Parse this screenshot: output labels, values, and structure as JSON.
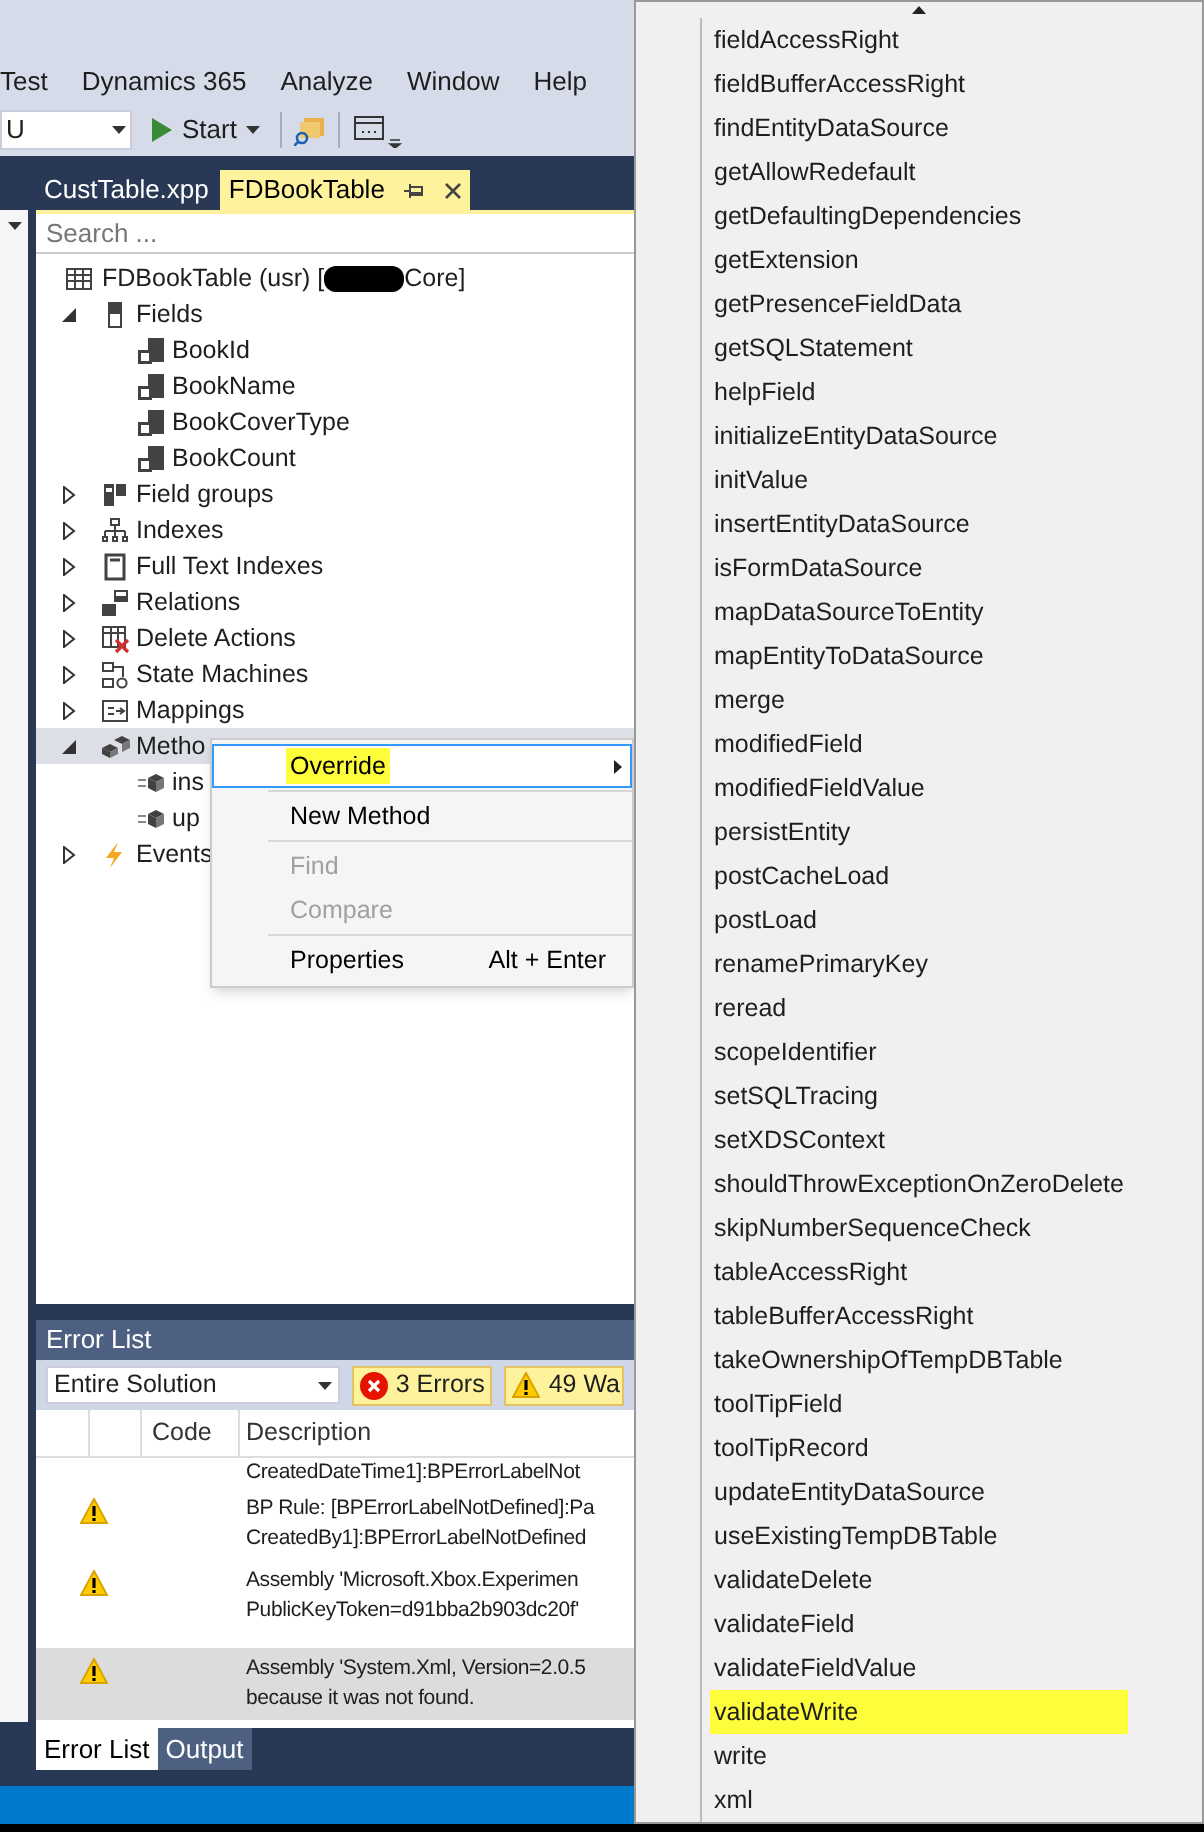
{
  "menu_bar": [
    "Test",
    "Dynamics 365",
    "Analyze",
    "Window",
    "Help"
  ],
  "toolbar": {
    "config_value": "U",
    "start_label": "Start"
  },
  "document_tabs": [
    {
      "label": "CustTable.xpp",
      "selected": false
    },
    {
      "label": "FDBookTable",
      "selected": true
    }
  ],
  "search": {
    "placeholder": "Search ..."
  },
  "tree": {
    "label": "FDBookTable (usr) [",
    "label_end": "Core]",
    "kind": "table",
    "children": [
      {
        "label": "Fields",
        "kind": "fields",
        "expanded": true,
        "selected": false,
        "children": [
          {
            "label": "BookId",
            "kind": "field",
            "selected": false
          },
          {
            "label": "BookName",
            "kind": "field",
            "selected": false
          },
          {
            "label": "BookCoverType",
            "kind": "field",
            "selected": false
          },
          {
            "label": "BookCount",
            "kind": "field",
            "selected": false
          }
        ]
      },
      {
        "label": "Field groups",
        "kind": "group",
        "expanded": false,
        "selected": false
      },
      {
        "label": "Indexes",
        "kind": "index",
        "expanded": false,
        "selected": false
      },
      {
        "label": "Full Text Indexes",
        "kind": "fulltext",
        "expanded": false,
        "selected": false
      },
      {
        "label": "Relations",
        "kind": "relation",
        "expanded": false,
        "selected": false
      },
      {
        "label": "Delete Actions",
        "kind": "delete",
        "expanded": false,
        "selected": false
      },
      {
        "label": "State Machines",
        "kind": "state",
        "expanded": false,
        "selected": false
      },
      {
        "label": "Mappings",
        "kind": "mapping",
        "expanded": false,
        "selected": false
      },
      {
        "label": "Metho",
        "kind": "methods",
        "expanded": true,
        "selected": true,
        "children": [
          {
            "label": "ins",
            "kind": "method",
            "selected": false
          },
          {
            "label": "up",
            "kind": "method",
            "selected": false
          }
        ]
      },
      {
        "label": "Events",
        "kind": "event",
        "expanded": false,
        "selected": false
      }
    ]
  },
  "context_menu": [
    [
      {
        "label": "Override",
        "submenu": true,
        "selected": true,
        "highlighted": true,
        "disabled": false
      }
    ],
    [
      {
        "label": "New Method",
        "submenu": false,
        "selected": false,
        "highlighted": false,
        "disabled": false
      }
    ],
    [
      {
        "label": "Find",
        "submenu": false,
        "selected": false,
        "highlighted": false,
        "disabled": true
      },
      {
        "label": "Compare",
        "submenu": false,
        "selected": false,
        "highlighted": false,
        "disabled": true
      }
    ],
    [
      {
        "label": "Properties",
        "shortcut": "Alt + Enter",
        "submenu": false,
        "selected": false,
        "highlighted": false,
        "disabled": false
      }
    ]
  ],
  "error_list": {
    "title": "Error List",
    "scope": "Entire Solution",
    "errors": "3 Errors",
    "warnings": "49 Wa",
    "columns": [
      "Code",
      "Description"
    ],
    "rows": [
      {
        "warning": false,
        "selected": false,
        "lines": [
          "CreatedDateTime1]:BPErrorLabelNot"
        ]
      },
      {
        "warning": true,
        "selected": false,
        "lines": [
          "BP Rule: [BPErrorLabelNotDefined]:Pa",
          "CreatedBy1]:BPErrorLabelNotDefined"
        ]
      },
      {
        "warning": true,
        "selected": false,
        "lines": [
          "Assembly 'Microsoft.Xbox.Experimen",
          "PublicKeyToken=d91bba2b903dc20f'"
        ]
      },
      {
        "warning": true,
        "selected": true,
        "lines": [
          "Assembly 'System.Xml, Version=2.0.5",
          "because it was not found."
        ]
      }
    ]
  },
  "bottom_tabs": [
    {
      "label": "Error List",
      "selected": true
    },
    {
      "label": "Output",
      "selected": false
    }
  ],
  "override_menu": [
    {
      "label": "fieldAccessRight",
      "highlighted": false
    },
    {
      "label": "fieldBufferAccessRight",
      "highlighted": false
    },
    {
      "label": "findEntityDataSource",
      "highlighted": false
    },
    {
      "label": "getAllowRedefault",
      "highlighted": false
    },
    {
      "label": "getDefaultingDependencies",
      "highlighted": false
    },
    {
      "label": "getExtension",
      "highlighted": false
    },
    {
      "label": "getPresenceFieldData",
      "highlighted": false
    },
    {
      "label": "getSQLStatement",
      "highlighted": false
    },
    {
      "label": "helpField",
      "highlighted": false
    },
    {
      "label": "initializeEntityDataSource",
      "highlighted": false
    },
    {
      "label": "initValue",
      "highlighted": false
    },
    {
      "label": "insertEntityDataSource",
      "highlighted": false
    },
    {
      "label": "isFormDataSource",
      "highlighted": false
    },
    {
      "label": "mapDataSourceToEntity",
      "highlighted": false
    },
    {
      "label": "mapEntityToDataSource",
      "highlighted": false
    },
    {
      "label": "merge",
      "highlighted": false
    },
    {
      "label": "modifiedField",
      "highlighted": false
    },
    {
      "label": "modifiedFieldValue",
      "highlighted": false
    },
    {
      "label": "persistEntity",
      "highlighted": false
    },
    {
      "label": "postCacheLoad",
      "highlighted": false
    },
    {
      "label": "postLoad",
      "highlighted": false
    },
    {
      "label": "renamePrimaryKey",
      "highlighted": false
    },
    {
      "label": "reread",
      "highlighted": false
    },
    {
      "label": "scopeIdentifier",
      "highlighted": false
    },
    {
      "label": "setSQLTracing",
      "highlighted": false
    },
    {
      "label": "setXDSContext",
      "highlighted": false
    },
    {
      "label": "shouldThrowExceptionOnZeroDelete",
      "highlighted": false
    },
    {
      "label": "skipNumberSequenceCheck",
      "highlighted": false
    },
    {
      "label": "tableAccessRight",
      "highlighted": false
    },
    {
      "label": "tableBufferAccessRight",
      "highlighted": false
    },
    {
      "label": "takeOwnershipOfTempDBTable",
      "highlighted": false
    },
    {
      "label": "toolTipField",
      "highlighted": false
    },
    {
      "label": "toolTipRecord",
      "highlighted": false
    },
    {
      "label": "updateEntityDataSource",
      "highlighted": false
    },
    {
      "label": "useExistingTempDBTable",
      "highlighted": false
    },
    {
      "label": "validateDelete",
      "highlighted": false
    },
    {
      "label": "validateField",
      "highlighted": false
    },
    {
      "label": "validateFieldValue",
      "highlighted": false
    },
    {
      "label": "validateWrite",
      "highlighted": true
    },
    {
      "label": "write",
      "highlighted": false
    },
    {
      "label": "xml",
      "highlighted": false
    }
  ]
}
